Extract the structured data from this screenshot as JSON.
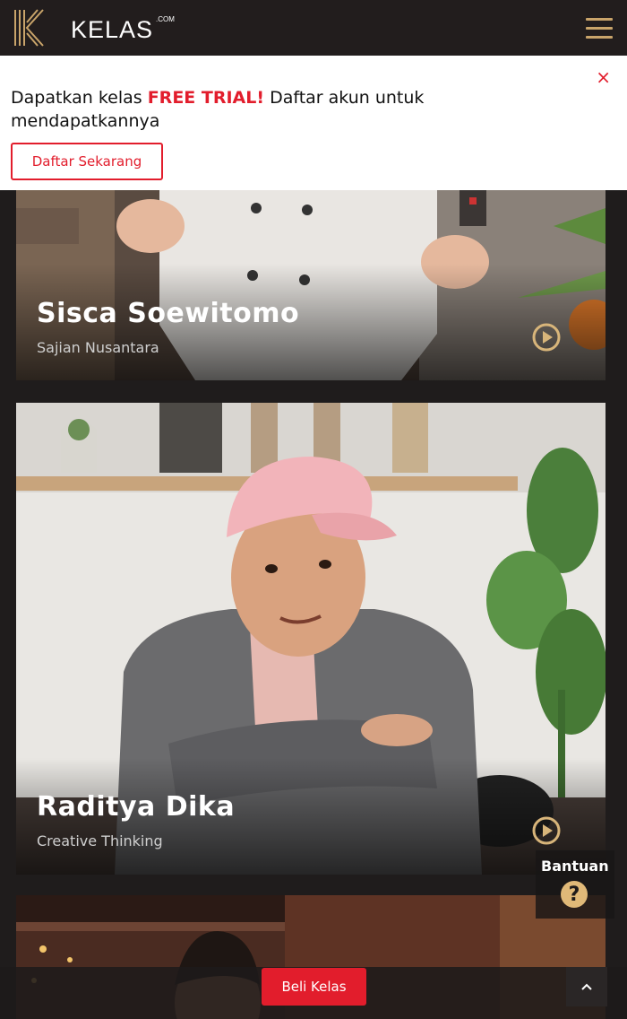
{
  "header": {
    "brand": "KELAS",
    "brand_sup": ".COM",
    "logo_letter": "K"
  },
  "banner": {
    "text_before": "Dapatkan kelas ",
    "text_highlight": "FREE TRIAL!",
    "text_after": " Daftar akun untuk mendapatkannya",
    "close": "×",
    "cta": "Daftar Sekarang"
  },
  "courses": [
    {
      "name": "Sisca Soewitomo",
      "subtitle": "Sajian Nusantara"
    },
    {
      "name": "Raditya Dika",
      "subtitle": "Creative Thinking"
    }
  ],
  "help": {
    "label": "Bantuan",
    "icon": "?"
  },
  "bottom": {
    "buy_label": "Beli Kelas",
    "scroll_top": "⌃"
  },
  "colors": {
    "accent_red": "#e21d2c",
    "gold": "#c9a46a",
    "dark": "#1f1c1c"
  },
  "icons": [
    "logo-icon",
    "menu-icon",
    "close-icon",
    "play-icon",
    "help-icon",
    "chevron-up-icon"
  ]
}
